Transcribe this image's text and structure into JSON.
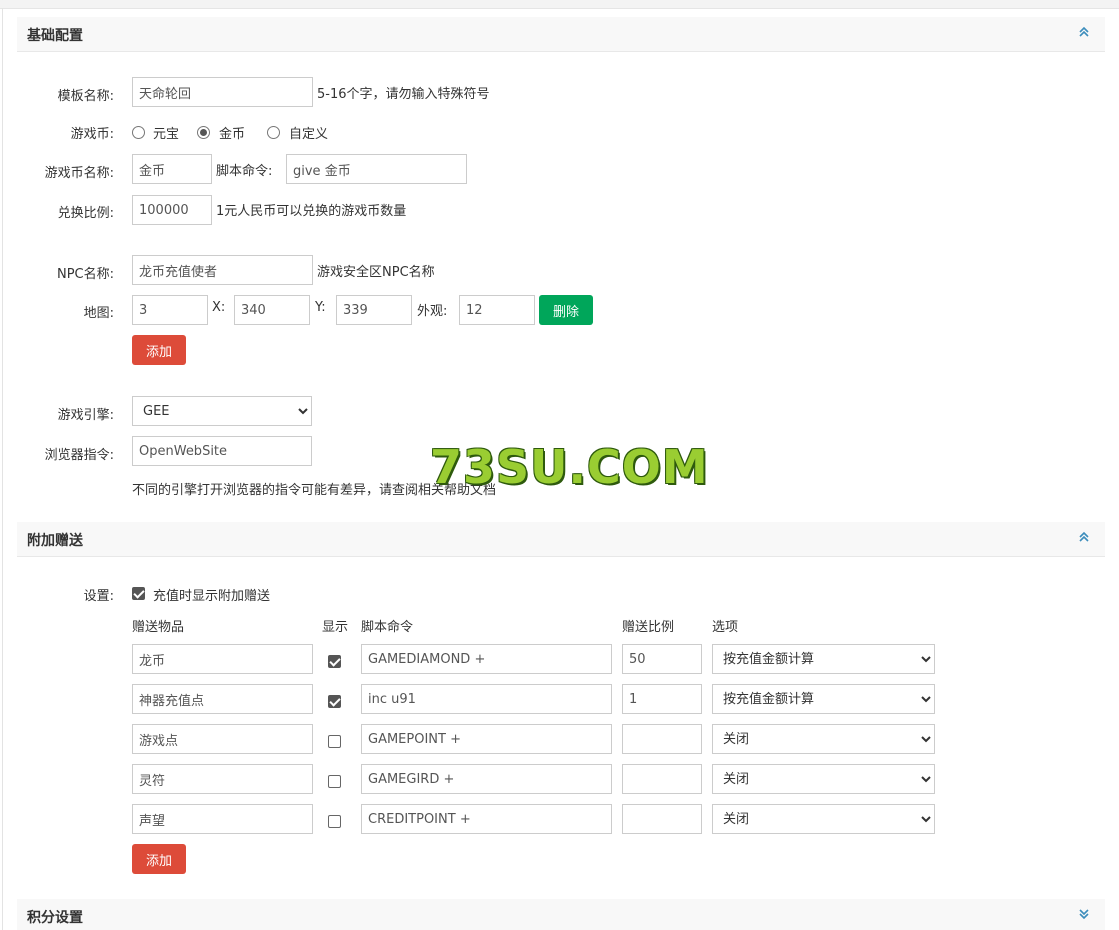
{
  "sections": {
    "basic": {
      "title": "基础配置"
    },
    "bonus": {
      "title": "附加赠送"
    },
    "points": {
      "title": "积分设置"
    }
  },
  "basic": {
    "template_name": {
      "label": "模板名称:",
      "value": "天命轮回",
      "hint": "5-16个字，请勿输入特殊符号"
    },
    "currency": {
      "label": "游戏币:",
      "options": [
        "元宝",
        "金币",
        "自定义"
      ],
      "selected": "金币"
    },
    "currency_name": {
      "label": "游戏币名称:",
      "value": "金币",
      "script_label": "脚本命令:",
      "script_value": "give 金币"
    },
    "exchange": {
      "label": "兑换比例:",
      "value": "100000",
      "hint": "1元人民币可以兑换的游戏币数量"
    },
    "npc": {
      "label": "NPC名称:",
      "value": "龙币充值使者",
      "hint": "游戏安全区NPC名称"
    },
    "map": {
      "label": "地图:",
      "map_value": "3",
      "x_label": "X:",
      "x_value": "340",
      "y_label": "Y:",
      "y_value": "339",
      "look_label": "外观:",
      "look_value": "12",
      "delete_label": "删除"
    },
    "add_label": "添加",
    "engine": {
      "label": "游戏引擎:",
      "value": "GEE"
    },
    "browser": {
      "label": "浏览器指令:",
      "value": "OpenWebSite",
      "hint": "不同的引擎打开浏览器的指令可能有差异，请查阅相关帮助文档"
    }
  },
  "bonus": {
    "setting_label": "设置:",
    "show_bonus_label": "充值时显示附加赠送",
    "show_bonus_checked": true,
    "headers": {
      "item": "赠送物品",
      "show": "显示",
      "script": "脚本命令",
      "ratio": "赠送比例",
      "option": "选项"
    },
    "rows": [
      {
        "item": "龙币",
        "show": true,
        "script": "GAMEDIAMOND +",
        "ratio": "50",
        "option": "按充值金额计算"
      },
      {
        "item": "神器充值点",
        "show": true,
        "script": "inc u91",
        "ratio": "1",
        "option": "按充值金额计算"
      },
      {
        "item": "游戏点",
        "show": false,
        "script": "GAMEPOINT +",
        "ratio": "",
        "option": "关闭"
      },
      {
        "item": "灵符",
        "show": false,
        "script": "GAMEGIRD +",
        "ratio": "",
        "option": "关闭"
      },
      {
        "item": "声望",
        "show": false,
        "script": "CREDITPOINT +",
        "ratio": "",
        "option": "关闭"
      }
    ],
    "add_label": "添加"
  },
  "watermark": "73SU.COM",
  "colors": {
    "add_button": "#dd4b39",
    "delete_button": "#00a65a",
    "watermark": "#9acd32",
    "chevron": "#3c8dbc"
  }
}
